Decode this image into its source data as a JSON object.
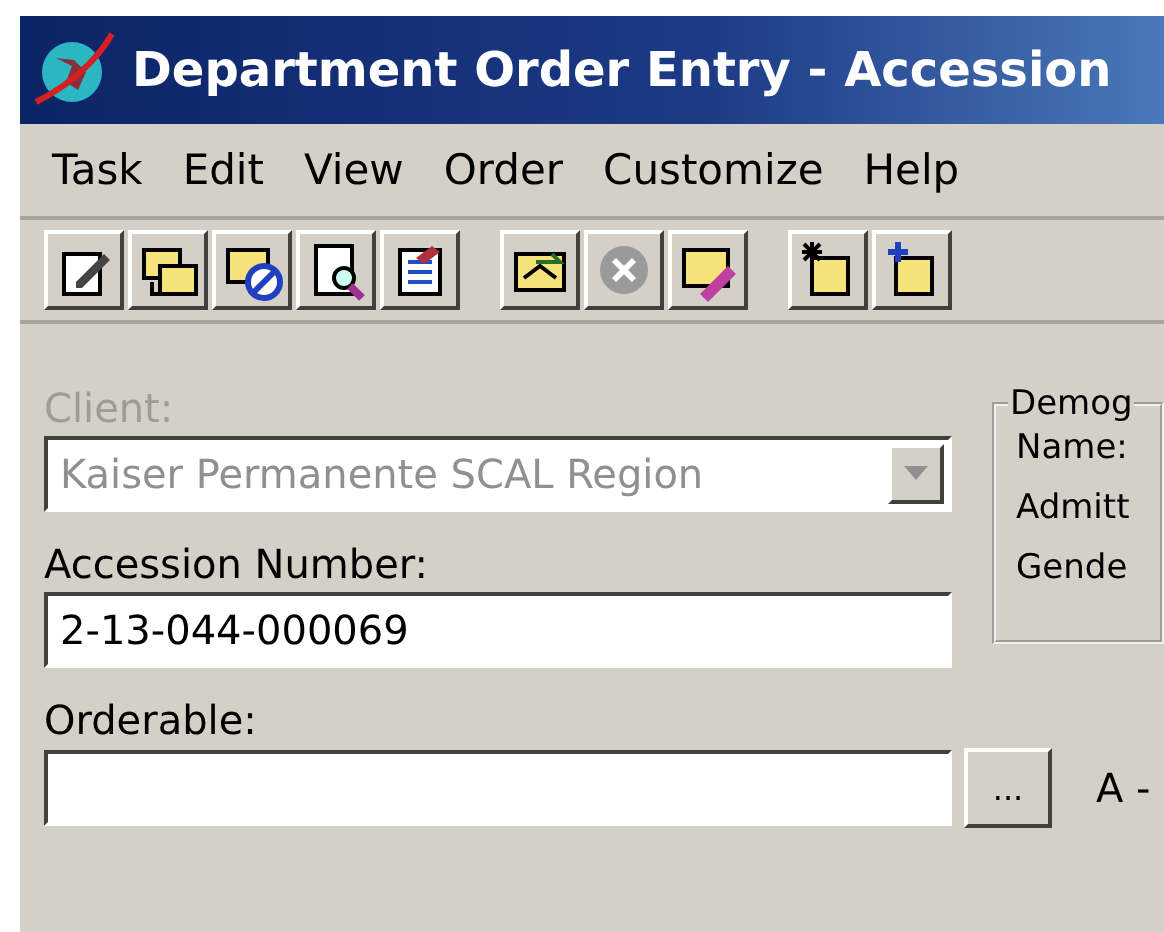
{
  "window": {
    "title": "Department Order Entry - Accession"
  },
  "menu": [
    "Task",
    "Edit",
    "View",
    "Order",
    "Customize",
    "Help"
  ],
  "client": {
    "label": "Client:",
    "value": "Kaiser Permanente SCAL Region",
    "disabled": true
  },
  "accession": {
    "label": "Accession Number:",
    "value": "2-13-044-000069"
  },
  "orderable": {
    "label": "Orderable:",
    "button": "...",
    "suffix": "A -"
  },
  "demographics": {
    "legend": "Demog",
    "fields": [
      "Name:",
      "Admitt",
      "Gende"
    ]
  }
}
